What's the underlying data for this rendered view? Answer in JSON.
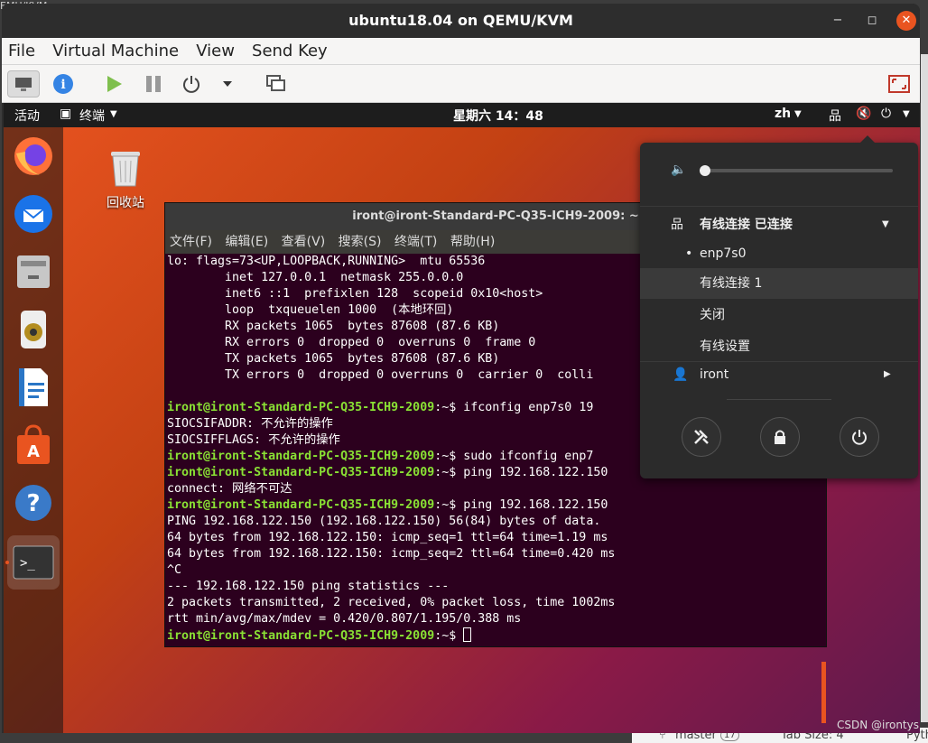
{
  "host": {
    "topfrag": "EMU/KVM",
    "statusbar": {
      "branch": "master",
      "badge": "17",
      "tabsize": "Tab Size: 4",
      "lang": "Pyth"
    },
    "watermark": "CSDN @irontys"
  },
  "window": {
    "title": "ubuntu18.04 on QEMU/KVM"
  },
  "menubar": {
    "file": "File",
    "vm": "Virtual Machine",
    "view": "View",
    "sendkey": "Send Key"
  },
  "toolbar": {
    "icons": [
      "monitor-icon",
      "info-icon",
      "play-icon",
      "pause-icon",
      "power-icon",
      "dropdown-icon",
      "screenshot-icon",
      "fullscreen-icon"
    ]
  },
  "guest": {
    "topbar": {
      "activities": "活动",
      "app": "终端",
      "clock": "星期六 14：48",
      "lang": "zh"
    },
    "trash": {
      "label": "回收站"
    },
    "terminal": {
      "title": "iront@iront-Standard-PC-Q35-ICH9-2009: ~",
      "menu": [
        "文件(F)",
        "编辑(E)",
        "查看(V)",
        "搜索(S)",
        "终端(T)",
        "帮助(H)"
      ],
      "lines": [
        {
          "text": "lo: flags=73<UP,LOOPBACK,RUNNING>  mtu 65536"
        },
        {
          "text": "        inet 127.0.0.1  netmask 255.0.0.0"
        },
        {
          "text": "        inet6 ::1  prefixlen 128  scopeid 0x10<host>"
        },
        {
          "text": "        loop  txqueuelen 1000  (本地环回)"
        },
        {
          "text": "        RX packets 1065  bytes 87608 (87.6 KB)"
        },
        {
          "text": "        RX errors 0  dropped 0  overruns 0  frame 0"
        },
        {
          "text": "        TX packets 1065  bytes 87608 (87.6 KB)"
        },
        {
          "text": "        TX errors 0  dropped 0 overruns 0  carrier 0  colli"
        },
        {
          "text": ""
        },
        {
          "prompt": true,
          "cmd": "ifconfig enp7s0 19"
        },
        {
          "text": "SIOCSIFADDR: 不允许的操作"
        },
        {
          "text": "SIOCSIFFLAGS: 不允许的操作"
        },
        {
          "prompt": true,
          "cmd": "sudo ifconfig enp7"
        },
        {
          "prompt": true,
          "cmd": "ping 192.168.122.150"
        },
        {
          "text": "connect: 网络不可达"
        },
        {
          "prompt": true,
          "cmd": "ping 192.168.122.150"
        },
        {
          "text": "PING 192.168.122.150 (192.168.122.150) 56(84) bytes of data."
        },
        {
          "text": "64 bytes from 192.168.122.150: icmp_seq=1 ttl=64 time=1.19 ms"
        },
        {
          "text": "64 bytes from 192.168.122.150: icmp_seq=2 ttl=64 time=0.420 ms"
        },
        {
          "text": "^C"
        },
        {
          "text": "--- 192.168.122.150 ping statistics ---"
        },
        {
          "text": "2 packets transmitted, 2 received, 0% packet loss, time 1002ms"
        },
        {
          "text": "rtt min/avg/max/mdev = 0.420/0.807/1.195/0.388 ms"
        },
        {
          "prompt": true,
          "cmd": "",
          "cursor": true
        }
      ],
      "prompt_user": "iront@iront-Standard-PC-Q35-ICH9-2009",
      "prompt_path": ":~$ "
    },
    "popup": {
      "volume": 0.0,
      "wired_title": "有线连接 已连接",
      "iface": "enp7s0",
      "conn1": "有线连接 1",
      "off": "关闭",
      "settings": "有线设置",
      "user": "iront"
    }
  }
}
